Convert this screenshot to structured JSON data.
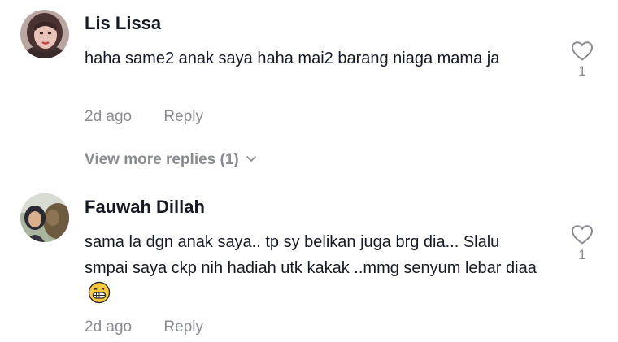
{
  "comments": [
    {
      "username": "Lis Lissa",
      "text": "haha same2 anak saya haha mai2 barang niaga mama ja",
      "date": "2d ago",
      "reply_label": "Reply",
      "like_count": "1",
      "avatar_icon": "avatar-photo"
    },
    {
      "username": "Fauwah Dillah",
      "text": "sama la dgn anak saya.. tp sy belikan juga brg dia... Slalu smpai saya ckp nih hadiah utk kakak ..mmg senyum lebar diaa",
      "emoji": "grinning-face-emoji",
      "date": "2d ago",
      "reply_label": "Reply",
      "like_count": "1",
      "avatar_icon": "avatar-photo"
    }
  ],
  "view_more": {
    "label": "View more replies (1)",
    "icon": "chevron-down-icon"
  },
  "colors": {
    "text": "#161823",
    "muted": "#8a8b91",
    "background": "#ffffff"
  }
}
